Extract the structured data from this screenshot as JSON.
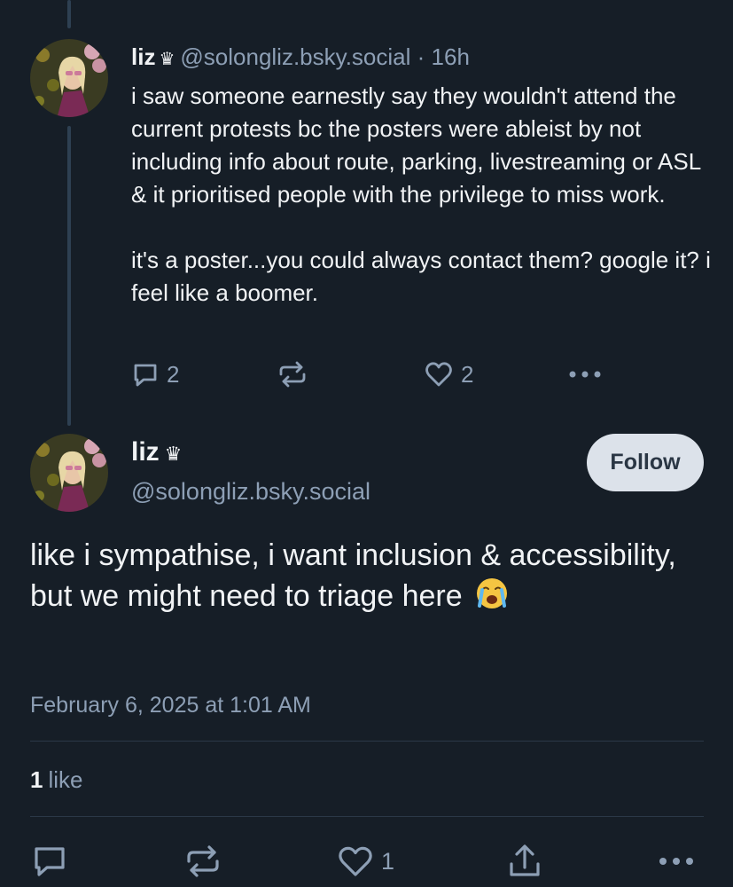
{
  "reply_parent": {
    "author_name": "liz",
    "author_badge_icon": "crown-icon",
    "handle": "@solongliz.bsky.social",
    "separator": "·",
    "time_ago": "16h",
    "text_paragraphs": [
      "i saw someone earnestly say they wouldn't attend the current protests bc the posters were ableist by not including info about route, parking, livestreaming or ASL & it prioritised people with the privilege to miss work.",
      "it's a poster...you could always contact them? google it? i feel like a boomer."
    ],
    "actions": {
      "reply_count": "2",
      "repost_count": "",
      "like_count": "2"
    }
  },
  "main_post": {
    "author_name": "liz",
    "author_badge_icon": "crown-icon",
    "handle": "@solongliz.bsky.social",
    "follow_label": "Follow",
    "text": "like i sympathise, i want inclusion & accessibility, but we might need to triage here",
    "emoji": "loudly-crying-face",
    "timestamp": "February 6, 2025 at 1:01 AM",
    "likes_count": "1",
    "likes_label": "like",
    "actions": {
      "like_count": "1"
    }
  },
  "colors": {
    "background": "#161e27",
    "text_primary": "#f1f3f5",
    "text_muted": "#8d9fb5",
    "thread_line": "#2e4052",
    "follow_button_bg": "#dce2ea",
    "divider": "#2b3847"
  }
}
